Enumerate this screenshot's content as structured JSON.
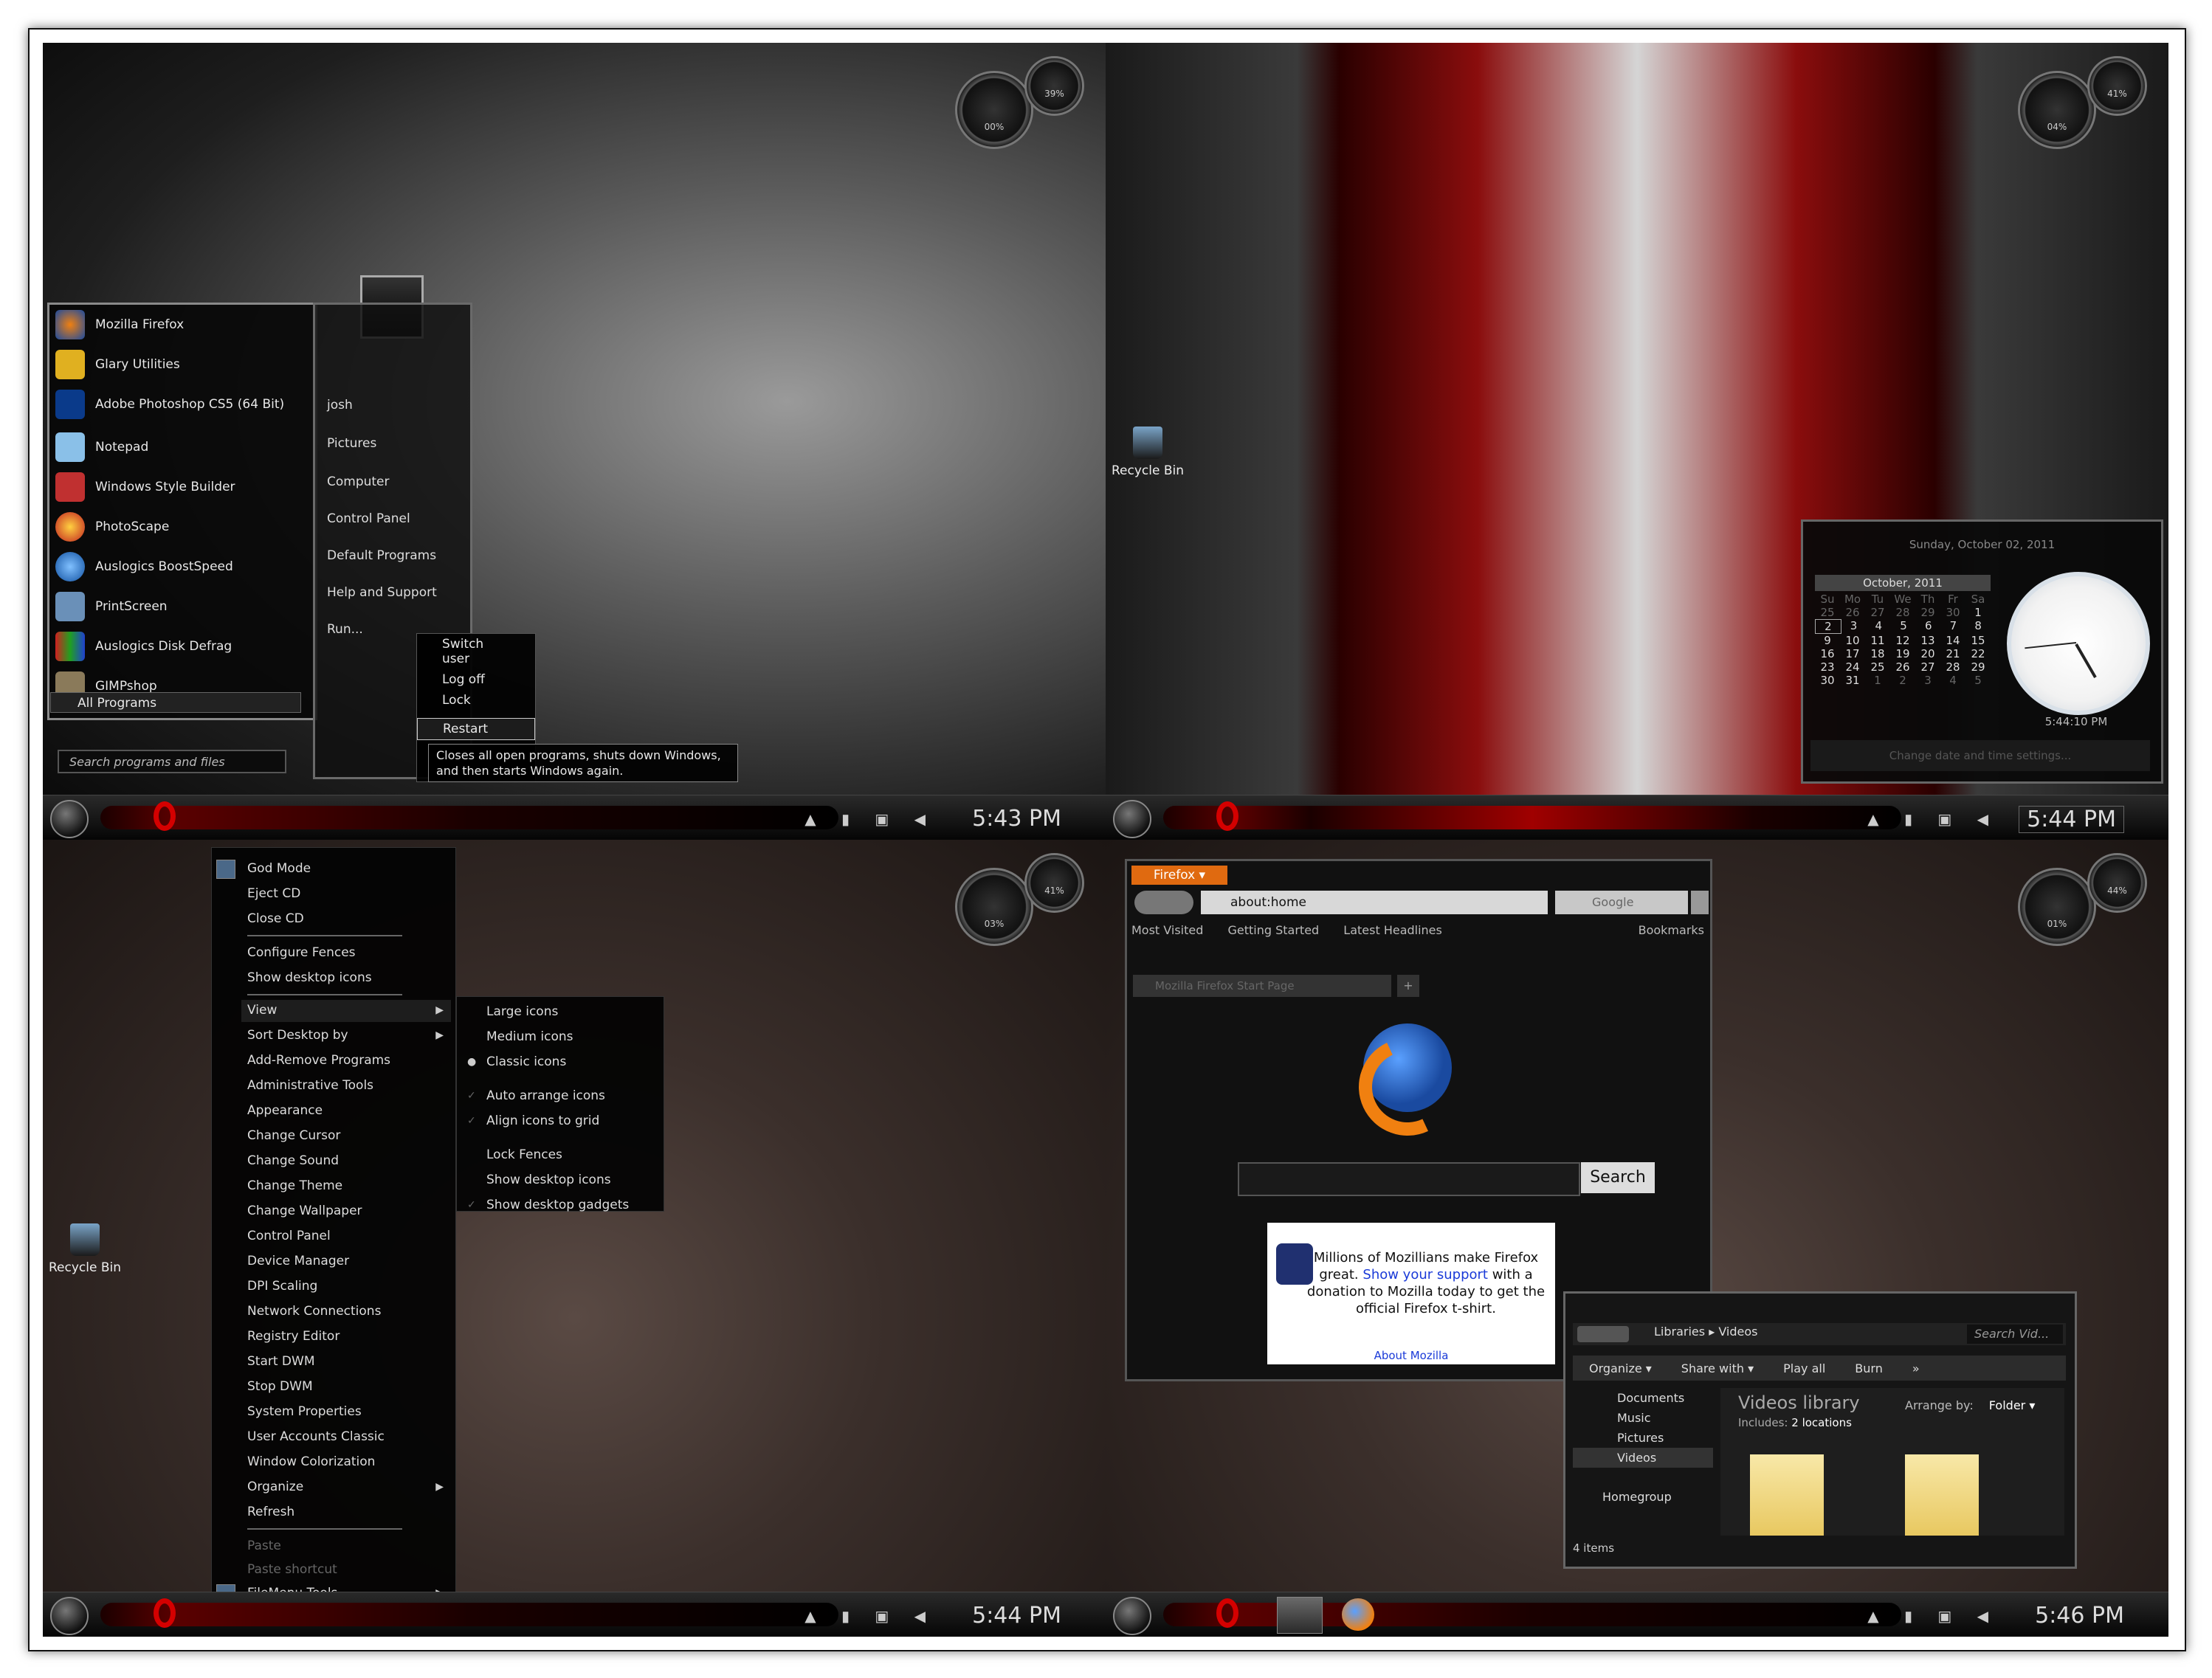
{
  "q1": {
    "clock": "5:43 PM",
    "gauges": [
      "00%",
      "39%"
    ],
    "programs": [
      "Mozilla Firefox",
      "Glary Utilities",
      "Adobe Photoshop CS5 (64 Bit)",
      "Notepad",
      "Windows Style Builder",
      "PhotoScape",
      "Auslogics BoostSpeed",
      "PrintScreen",
      "Auslogics Disk Defrag",
      "GIMPshop"
    ],
    "all_programs": "All Programs",
    "search_placeholder": "Search programs and files",
    "right_links": [
      "josh",
      "Pictures",
      "Computer",
      "Control Panel",
      "Default Programs",
      "Help and Support",
      "Run..."
    ],
    "shutdown_menu": [
      "Switch user",
      "Log off",
      "Lock",
      "Restart"
    ],
    "tooltip": "Closes all open programs, shuts down Windows, and then starts Windows again."
  },
  "q2": {
    "clock": "5:44 PM",
    "gauges": [
      "04%",
      "41%"
    ],
    "recycle_bin": "Recycle Bin",
    "calendar": {
      "header": "Sunday, October 02, 2011",
      "month": "October, 2011",
      "weekdays": [
        "Su",
        "Mo",
        "Tu",
        "We",
        "Th",
        "Fr",
        "Sa"
      ],
      "rows": [
        [
          "25",
          "26",
          "27",
          "28",
          "29",
          "30",
          "1"
        ],
        [
          "2",
          "3",
          "4",
          "5",
          "6",
          "7",
          "8"
        ],
        [
          "9",
          "10",
          "11",
          "12",
          "13",
          "14",
          "15"
        ],
        [
          "16",
          "17",
          "18",
          "19",
          "20",
          "21",
          "22"
        ],
        [
          "23",
          "24",
          "25",
          "26",
          "27",
          "28",
          "29"
        ],
        [
          "30",
          "31",
          "1",
          "2",
          "3",
          "4",
          "5"
        ]
      ],
      "time": "5:44:10 PM",
      "change_link": "Change date and time settings..."
    }
  },
  "q3": {
    "clock": "5:44 PM",
    "gauges": [
      "03%",
      "41%"
    ],
    "recycle_bin": "Recycle Bin",
    "context_menu": [
      "God Mode",
      "Eject CD",
      "Close CD",
      "Configure Fences",
      "Show desktop icons",
      "View",
      "Sort Desktop by",
      "Add-Remove Programs",
      "Administrative Tools",
      "Appearance",
      "Change Cursor",
      "Change Sound",
      "Change Theme",
      "Change Wallpaper",
      "Control Panel",
      "Device Manager",
      "DPI Scaling",
      "Network Connections",
      "Registry Editor",
      "Start DWM",
      "Stop DWM",
      "System Properties",
      "User Accounts Classic",
      "Window Colorization",
      "Organize",
      "Refresh",
      "Paste",
      "Paste shortcut",
      "FileMenu Tools"
    ],
    "view_menu": [
      "Large icons",
      "Medium icons",
      "Classic icons",
      "Auto arrange icons",
      "Align icons to grid",
      "Lock Fences",
      "Show desktop icons",
      "Show desktop gadgets"
    ]
  },
  "q4": {
    "clock": "5:46 PM",
    "gauges": [
      "01%",
      "44%"
    ],
    "firefox": {
      "menu_button": "Firefox",
      "url": "about:home",
      "search_engine": "Google",
      "bookmarks": [
        "Most Visited",
        "Getting Started",
        "Latest Headlines"
      ],
      "bookmarks_right": "Bookmarks",
      "tab": "Mozilla Firefox Start Page",
      "search_button": "Search",
      "promo_pre": "Millions of Mozillians make Firefox great. ",
      "promo_link": "Show your support",
      "promo_post": " with a donation to Mozilla today to get the official Firefox t-shirt.",
      "about_link": "About Mozilla"
    },
    "explorer": {
      "crumb_1": "Libraries",
      "crumb_2": "Videos",
      "search": "Search Vid...",
      "toolbar": [
        "Organize ▾",
        "Share with ▾",
        "Play all",
        "Burn",
        "»"
      ],
      "nav": [
        "Documents",
        "Music",
        "Pictures",
        "Videos",
        "Homegroup"
      ],
      "title": "Videos library",
      "includes_label": "Includes:",
      "includes_value": "2 locations",
      "arrange_label": "Arrange by:",
      "arrange_value": "Folder ▾",
      "status": "4 items"
    }
  }
}
